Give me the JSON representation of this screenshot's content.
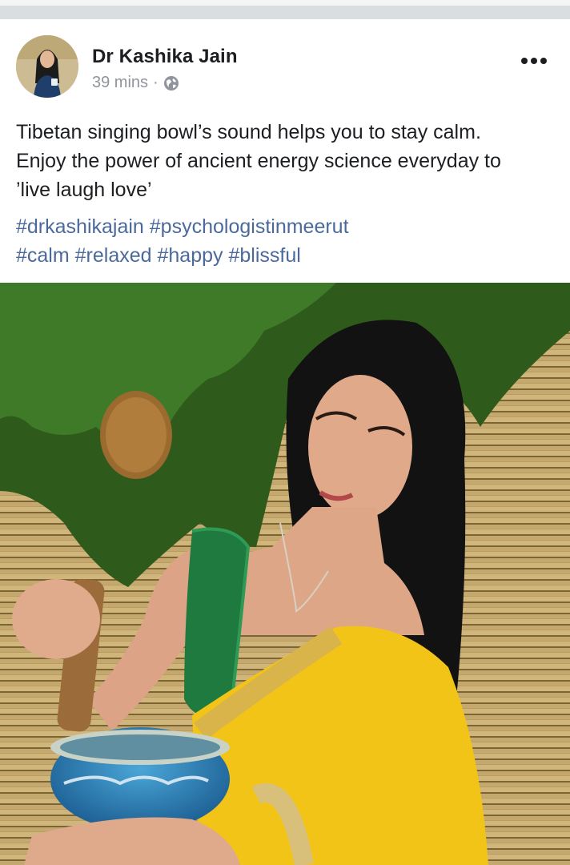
{
  "post": {
    "author": "Dr Kashika Jain",
    "time": "39 mins",
    "separator": "·",
    "privacy_icon": "globe-icon",
    "more_icon": "more-options-icon",
    "text_line1": "Tibetan singing bowl’s sound helps you to stay calm.",
    "text_line2": "Enjoy the power of ancient energy science everyday to",
    "text_line3": "’live laugh love’",
    "hashtags": [
      "#drkashikajain",
      "#psychologistinmeerut",
      "#calm",
      "#relaxed",
      "#happy",
      "#blissful"
    ]
  },
  "colors": {
    "text": "#1c1e21",
    "meta": "#90949c",
    "hashtag": "#4b6a9b",
    "saree": "#f2c418",
    "blouse": "#1e7a3e",
    "bowl": "#2a7fb8"
  }
}
